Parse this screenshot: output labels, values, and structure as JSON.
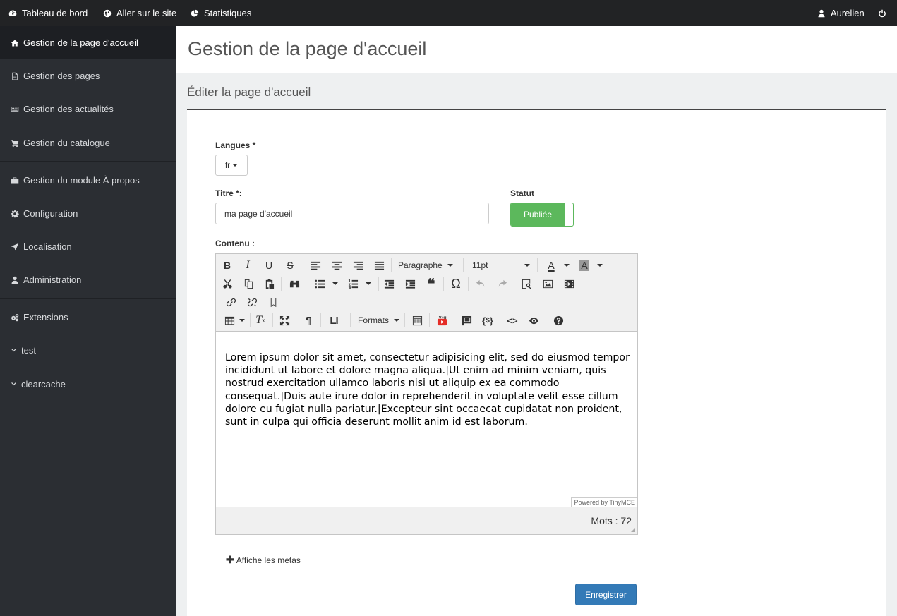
{
  "topbar": {
    "dashboard": "Tableau de bord",
    "visit_site": "Aller sur le site",
    "stats": "Statistiques",
    "user": "Aurelien"
  },
  "sidebar": {
    "items": [
      {
        "label": "Gestion de la page d'accueil",
        "icon": "home-icon"
      },
      {
        "label": "Gestion des pages",
        "icon": "file-icon"
      },
      {
        "label": "Gestion des actualités",
        "icon": "newspaper-icon"
      },
      {
        "label": "Gestion du catalogue",
        "icon": "cart-icon"
      },
      {
        "label": "Gestion du module À propos",
        "icon": "briefcase-icon"
      },
      {
        "label": "Configuration",
        "icon": "gear-icon"
      },
      {
        "label": "Localisation",
        "icon": "location-arrow-icon"
      },
      {
        "label": "Administration",
        "icon": "user-icon"
      },
      {
        "label": "Extensions",
        "icon": "gears-icon"
      },
      {
        "label": "test",
        "icon": "chevron-down-icon"
      },
      {
        "label": "clearcache",
        "icon": "chevron-down-icon"
      }
    ]
  },
  "page": {
    "title": "Gestion de la page d'accueil",
    "subtitle": "Éditer la page d'accueil"
  },
  "form": {
    "languages_label": "Langues *",
    "language_value": "fr",
    "title_label": "Titre *:",
    "title_value": "ma page d'accueil",
    "status_label": "Statut",
    "status_value": "Publiée",
    "content_label": "Contenu :",
    "metas_link": "Affiche les metas",
    "save_label": "Enregistrer"
  },
  "editor": {
    "block_format": "Paragraphe",
    "font_size": "11pt",
    "formats_menu": "Formats",
    "content": "Lorem ipsum dolor sit amet, consectetur adipisicing elit, sed do eiusmod tempor incididunt ut labore et dolore magna aliqua.|Ut enim ad minim veniam, quis nostrud exercitation ullamco laboris nisi ut aliquip ex ea commodo consequat.|Duis aute irure dolor in reprehenderit in voluptate velit esse cillum dolore eu fugiat nulla pariatur.|Excepteur sint occaecat cupidatat non proident, sunt in culpa qui officia deserunt mollit anim id est laborum.",
    "powered_by": "Powered by TinyMCE",
    "word_count": "Mots : 72"
  },
  "colors": {
    "topbar_bg": "#222325",
    "sidebar_bg": "#2b2e33",
    "sidebar_active_bg": "#1d1f23",
    "status_green": "#5cb85c",
    "primary_blue": "#337ab7"
  }
}
